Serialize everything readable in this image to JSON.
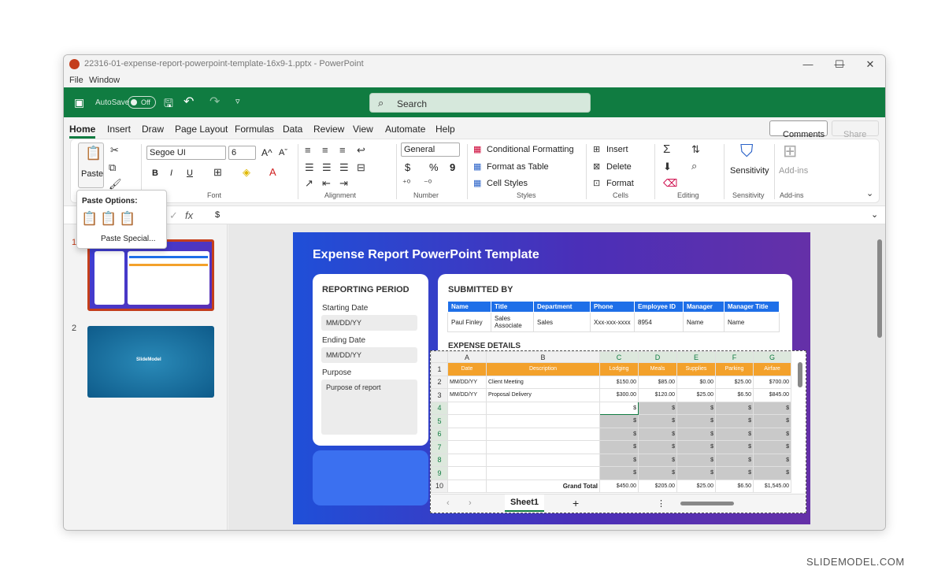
{
  "window": {
    "title": "22316-01-expense-report-powerpoint-template-16x9-1.pptx - PowerPoint",
    "controls": {
      "minimize": "—",
      "maximize": "☐",
      "close": "✕"
    }
  },
  "menubar": {
    "file": "File",
    "window": "Window"
  },
  "quick_access": {
    "autosave_label": "AutoSave",
    "autosave_state": "Off",
    "search_placeholder": "Search"
  },
  "tabs": [
    "Home",
    "Insert",
    "Draw",
    "Page Layout",
    "Formulas",
    "Data",
    "Review",
    "View",
    "Automate",
    "Help"
  ],
  "active_tab": "Home",
  "top_right": {
    "comments": "Comments",
    "share": "Share"
  },
  "ribbon": {
    "clipboard": {
      "paste": "Paste"
    },
    "font": {
      "name": "Segoe UI",
      "size": "6",
      "group": "Font",
      "bold": "B",
      "italic": "I",
      "underline": "U"
    },
    "alignment": {
      "group": "Alignment"
    },
    "number": {
      "format": "General",
      "group": "Number",
      "currency": "$",
      "percent": "%",
      "comma": "9"
    },
    "styles": {
      "conditional": "Conditional Formatting",
      "format_table": "Format as Table",
      "cell_styles": "Cell Styles",
      "group": "Styles"
    },
    "cells": {
      "insert": "Insert",
      "delete": "Delete",
      "format": "Format",
      "group": "Cells"
    },
    "editing": {
      "group": "Editing"
    },
    "sensitivity": {
      "label": "Sensitivity",
      "group": "Sensitivity"
    },
    "addins": {
      "label": "Add-ins",
      "group": "Add-ins"
    }
  },
  "formula_bar": {
    "fx": "fx",
    "value": "$"
  },
  "paste_popup": {
    "title": "Paste Options:",
    "paste_special": "Paste Special..."
  },
  "thumbnails": [
    {
      "number": "1"
    },
    {
      "number": "2",
      "logo": "SlideModel"
    }
  ],
  "slide": {
    "title": "Expense Report PowerPoint Template",
    "reporting": {
      "heading": "REPORTING PERIOD",
      "start_label": "Starting Date",
      "start_value": "MM/DD/YY",
      "end_label": "Ending Date",
      "end_value": "MM/DD/YY",
      "purpose_label": "Purpose",
      "purpose_value": "Purpose of report"
    },
    "submitted": {
      "heading": "SUBMITTED BY",
      "columns": [
        "Name",
        "Title",
        "Department",
        "Phone",
        "Employee ID",
        "Manager",
        "Manager Title"
      ],
      "row": [
        "Paul Finley",
        "Sales Associate",
        "Sales",
        "Xxx-xxx-xxxx",
        "8954",
        "Name",
        "Name"
      ]
    },
    "expense_heading": "EXPENSE DETAILS"
  },
  "excel": {
    "col_letters": [
      "A",
      "B",
      "C",
      "D",
      "E",
      "F",
      "G"
    ],
    "header": [
      "Date",
      "Description",
      "Lodging",
      "Meals",
      "Supplies",
      "Parking",
      "Airfare"
    ],
    "rows": [
      [
        "MM/DD/YY",
        "Client Meeting",
        "$150.00",
        "$85.00",
        "$0.00",
        "$25.00",
        "$700.00"
      ],
      [
        "MM/DD/YY",
        "Proposal Delivery",
        "$300.00",
        "$120.00",
        "$25.00",
        "$6.50",
        "$845.00"
      ]
    ],
    "dollar": "$",
    "grand_total_label": "Grand  Total",
    "grand_total": [
      "$450.00",
      "$205.00",
      "$25.00",
      "$6.50",
      "$1,545.00"
    ],
    "sheet_tab": "Sheet1",
    "add_sheet": "+"
  },
  "watermark": "SLIDEMODEL.COM",
  "colors": {
    "excel_green": "#107c41",
    "orange": "#f3a12b",
    "blue_header": "#1e6fe8",
    "ppt_red": "#c43e1c"
  }
}
